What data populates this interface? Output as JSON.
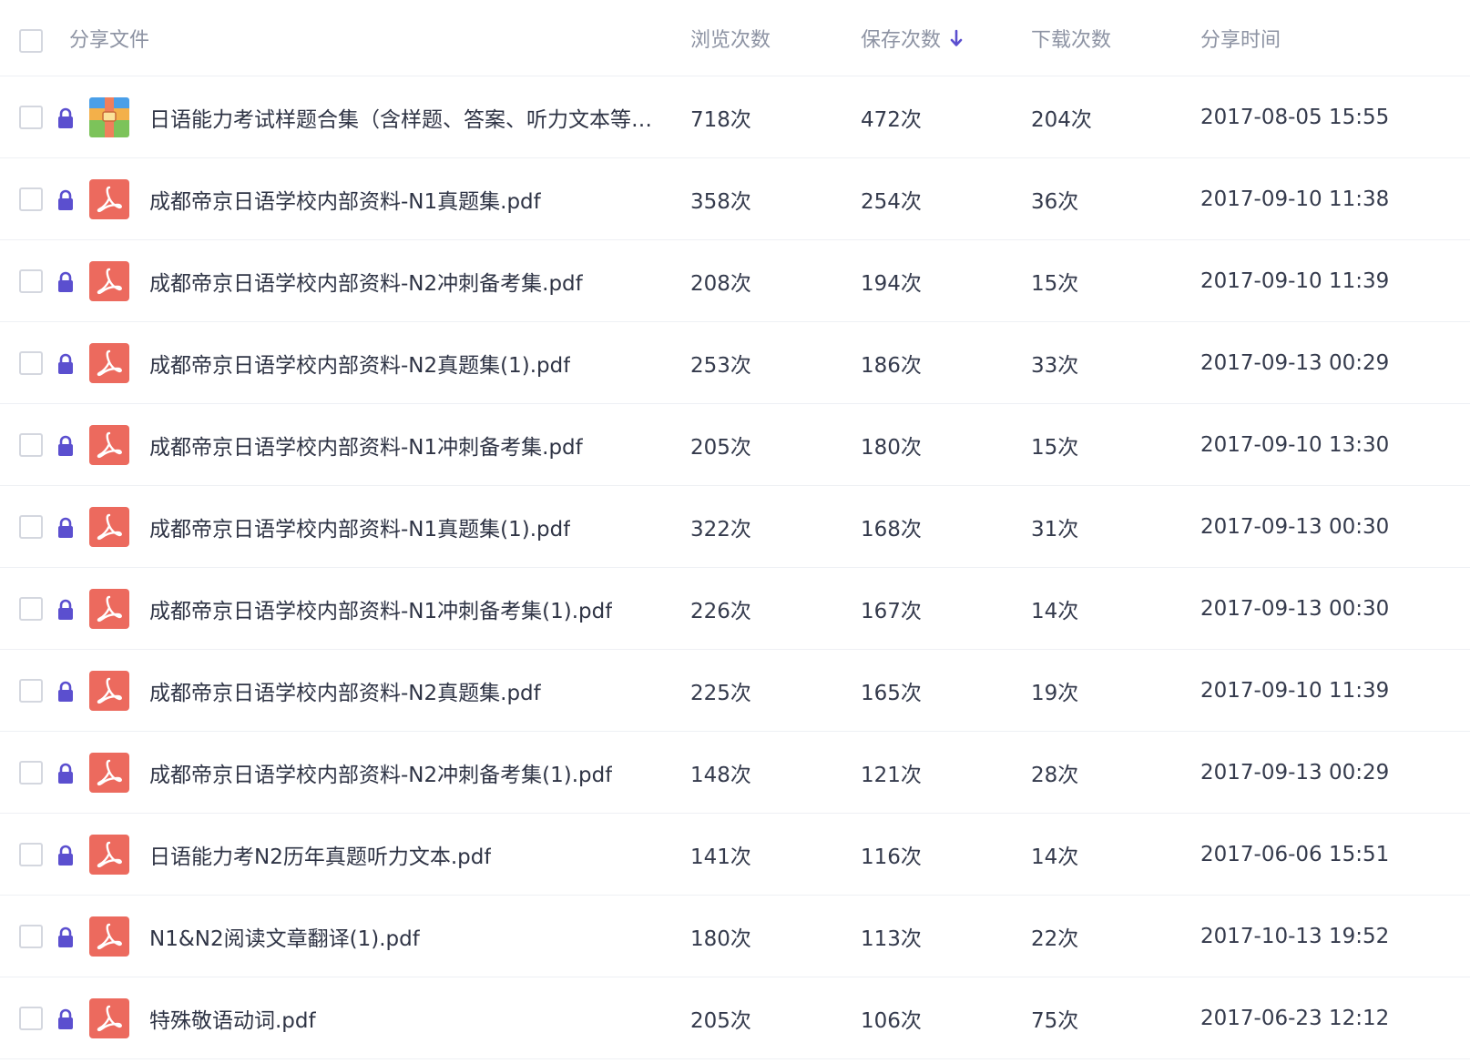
{
  "header": {
    "name": "分享文件",
    "views": "浏览次数",
    "saves": "保存次数",
    "downloads": "下载次数",
    "time": "分享时间"
  },
  "colors": {
    "accent": "#5b4fcf",
    "pdf_red": "#ec6a5e",
    "lock": "#5b4fcf"
  },
  "rows": [
    {
      "icon": "archive-icon",
      "name": "日语能力考试样题合集（含样题、答案、听力文本等…",
      "views": "718次",
      "saves": "472次",
      "downloads": "204次",
      "time": "2017-08-05 15:55"
    },
    {
      "icon": "pdf-icon",
      "name": "成都帝京日语学校内部资料-N1真题集.pdf",
      "views": "358次",
      "saves": "254次",
      "downloads": "36次",
      "time": "2017-09-10 11:38"
    },
    {
      "icon": "pdf-icon",
      "name": "成都帝京日语学校内部资料-N2冲刺备考集.pdf",
      "views": "208次",
      "saves": "194次",
      "downloads": "15次",
      "time": "2017-09-10 11:39"
    },
    {
      "icon": "pdf-icon",
      "name": "成都帝京日语学校内部资料-N2真题集(1).pdf",
      "views": "253次",
      "saves": "186次",
      "downloads": "33次",
      "time": "2017-09-13 00:29"
    },
    {
      "icon": "pdf-icon",
      "name": "成都帝京日语学校内部资料-N1冲刺备考集.pdf",
      "views": "205次",
      "saves": "180次",
      "downloads": "15次",
      "time": "2017-09-10 13:30"
    },
    {
      "icon": "pdf-icon",
      "name": "成都帝京日语学校内部资料-N1真题集(1).pdf",
      "views": "322次",
      "saves": "168次",
      "downloads": "31次",
      "time": "2017-09-13 00:30"
    },
    {
      "icon": "pdf-icon",
      "name": "成都帝京日语学校内部资料-N1冲刺备考集(1).pdf",
      "views": "226次",
      "saves": "167次",
      "downloads": "14次",
      "time": "2017-09-13 00:30"
    },
    {
      "icon": "pdf-icon",
      "name": "成都帝京日语学校内部资料-N2真题集.pdf",
      "views": "225次",
      "saves": "165次",
      "downloads": "19次",
      "time": "2017-09-10 11:39"
    },
    {
      "icon": "pdf-icon",
      "name": "成都帝京日语学校内部资料-N2冲刺备考集(1).pdf",
      "views": "148次",
      "saves": "121次",
      "downloads": "28次",
      "time": "2017-09-13 00:29"
    },
    {
      "icon": "pdf-icon",
      "name": "日语能力考N2历年真题听力文本.pdf",
      "views": "141次",
      "saves": "116次",
      "downloads": "14次",
      "time": "2017-06-06 15:51"
    },
    {
      "icon": "pdf-icon",
      "name": "N1&N2阅读文章翻译(1).pdf",
      "views": "180次",
      "saves": "113次",
      "downloads": "22次",
      "time": "2017-10-13 19:52"
    },
    {
      "icon": "pdf-icon",
      "name": "特殊敬语动词.pdf",
      "views": "205次",
      "saves": "106次",
      "downloads": "75次",
      "time": "2017-06-23 12:12"
    }
  ]
}
